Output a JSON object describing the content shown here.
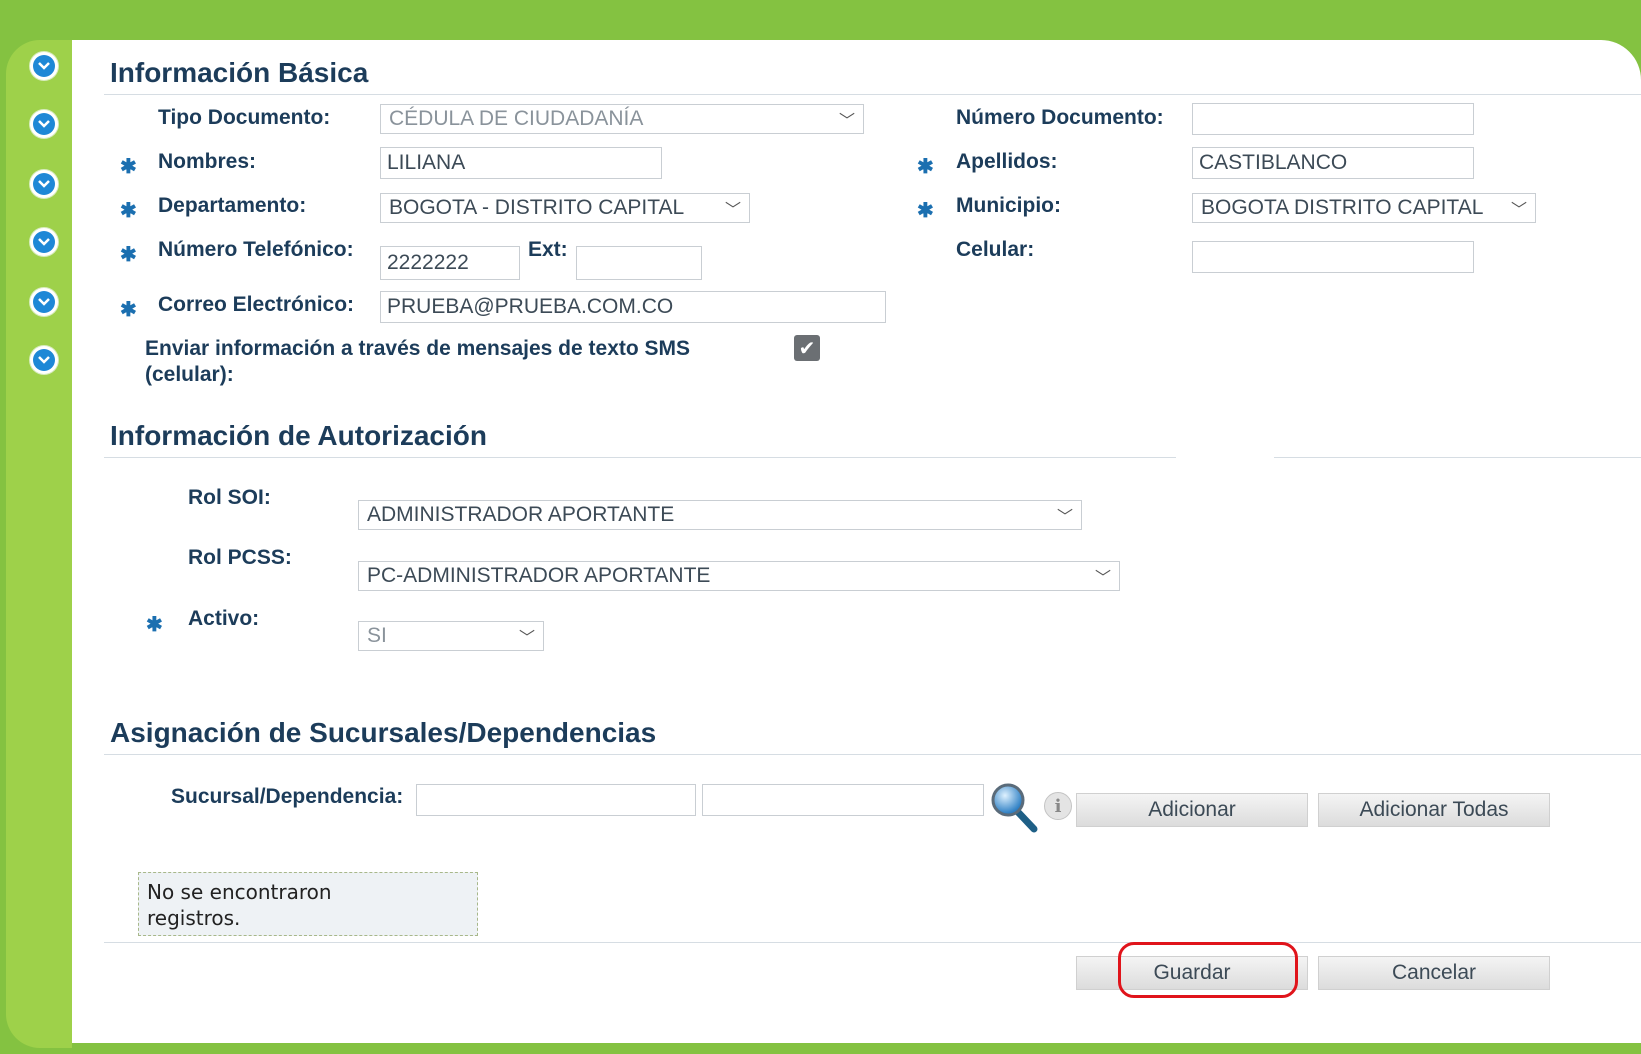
{
  "basic_info": {
    "title": "Información Básica",
    "tipo_documento": {
      "label": "Tipo Documento:",
      "value": "CÉDULA DE CIUDADANÍA"
    },
    "numero_documento": {
      "label": "Número Documento:",
      "value": ""
    },
    "nombres": {
      "label": "Nombres:",
      "value": "LILIANA"
    },
    "apellidos": {
      "label": "Apellidos:",
      "value": "CASTIBLANCO"
    },
    "departamento": {
      "label": "Departamento:",
      "value": "BOGOTA - DISTRITO CAPITAL"
    },
    "municipio": {
      "label": "Municipio:",
      "value": "BOGOTA DISTRITO CAPITAL"
    },
    "telefono": {
      "label": "Número Telefónico:",
      "value": "2222222"
    },
    "ext": {
      "label": "Ext:",
      "value": ""
    },
    "celular": {
      "label": "Celular:",
      "value": ""
    },
    "correo": {
      "label": "Correo Electrónico:",
      "value": "PRUEBA@PRUEBA.COM.CO"
    },
    "sms": {
      "label_line1": "Enviar información a través de mensajes de texto SMS",
      "label_line2": "(celular):",
      "checked": true
    }
  },
  "auth_info": {
    "title": "Información de Autorización",
    "rol_soi": {
      "label": "Rol SOI:",
      "value": "ADMINISTRADOR APORTANTE"
    },
    "rol_pcss": {
      "label": "Rol PCSS:",
      "value": "PC-ADMINISTRADOR APORTANTE"
    },
    "activo": {
      "label": "Activo:",
      "value": "SI"
    }
  },
  "branches": {
    "title": "Asignación de Sucursales/Dependencias",
    "sucursal_label": "Sucursal/Dependencia:",
    "sucursal_code": "",
    "sucursal_name": "",
    "add_button": "Adicionar",
    "add_all_button": "Adicionar Todas",
    "empty_line1": "No se encontraron",
    "empty_line2": "registros."
  },
  "actions": {
    "save": "Guardar",
    "cancel": "Cancelar"
  },
  "required_marker": "✱",
  "icons": {
    "side_toggle": "chevron-down-icon",
    "search": "magnifier-icon",
    "info": "info-icon"
  },
  "colors": {
    "frame_green": "#84c241",
    "heading": "#1c3c5a",
    "highlight": "#e0141b"
  }
}
